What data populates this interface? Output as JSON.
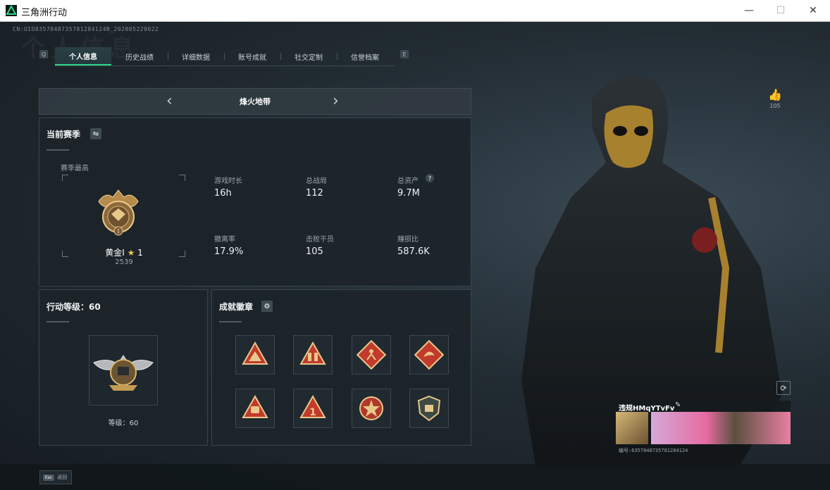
{
  "window": {
    "title": "三角洲行动",
    "minimize": "—",
    "maximize": "☐",
    "close": "✕"
  },
  "header": {
    "uid": "CN:UID8357848735781284124B_202805220022",
    "watermark": "个人信息"
  },
  "tabs": {
    "left_edge": "Q",
    "right_edge": "E",
    "items": [
      {
        "label": "个人信息",
        "active": true
      },
      {
        "label": "历史战绩",
        "active": false
      },
      {
        "label": "详细数据",
        "active": false
      },
      {
        "label": "账号成就",
        "active": false
      },
      {
        "label": "社交定制",
        "active": false
      },
      {
        "label": "信誉档案",
        "active": false
      }
    ]
  },
  "mode": {
    "title": "烽火地带",
    "prev_icon": "chevron-left-icon",
    "next_icon": "chevron-right-icon"
  },
  "season": {
    "title": "当前赛季",
    "best_label": "赛季最高",
    "rank_name": "黄金I",
    "rank_stars": "1",
    "rank_score": "2539",
    "stats": [
      {
        "label": "游戏时长",
        "value": "16h"
      },
      {
        "label": "总战局",
        "value": "112"
      },
      {
        "label": "总资产",
        "value": "9.7M",
        "help": "?"
      },
      {
        "label": "撤离率",
        "value": "17.9%"
      },
      {
        "label": "击败干员",
        "value": "105"
      },
      {
        "label": "赚损比",
        "value": "587.6K"
      }
    ]
  },
  "level": {
    "title": "行动等级：60",
    "caption": "等级：60"
  },
  "achievements": {
    "title": "成就徽章",
    "badges": [
      {
        "icon": "badge-mountain-icon",
        "color": "#c23a2c"
      },
      {
        "icon": "badge-soldiers-icon",
        "color": "#c23a2c"
      },
      {
        "icon": "badge-runner-icon",
        "color": "#c23a2c"
      },
      {
        "icon": "badge-dragon-icon",
        "color": "#c23a2c"
      },
      {
        "icon": "badge-fist-icon",
        "color": "#c23a2c"
      },
      {
        "icon": "badge-number-one-icon",
        "color": "#c23a2c"
      },
      {
        "icon": "badge-star-emblem-icon",
        "color": "#b0392a"
      },
      {
        "icon": "badge-shield-icon",
        "color": "#3d4a44"
      }
    ]
  },
  "profile": {
    "like_count": "105",
    "name": "违规HMqYTvFv",
    "id_text": "编号:6357848735781284124"
  },
  "bottom": {
    "esc_key": "Esc",
    "back_label": "返回"
  },
  "colors": {
    "accent": "#2fd58c",
    "panel": "#1c242a",
    "gold": "#c9a14a"
  }
}
